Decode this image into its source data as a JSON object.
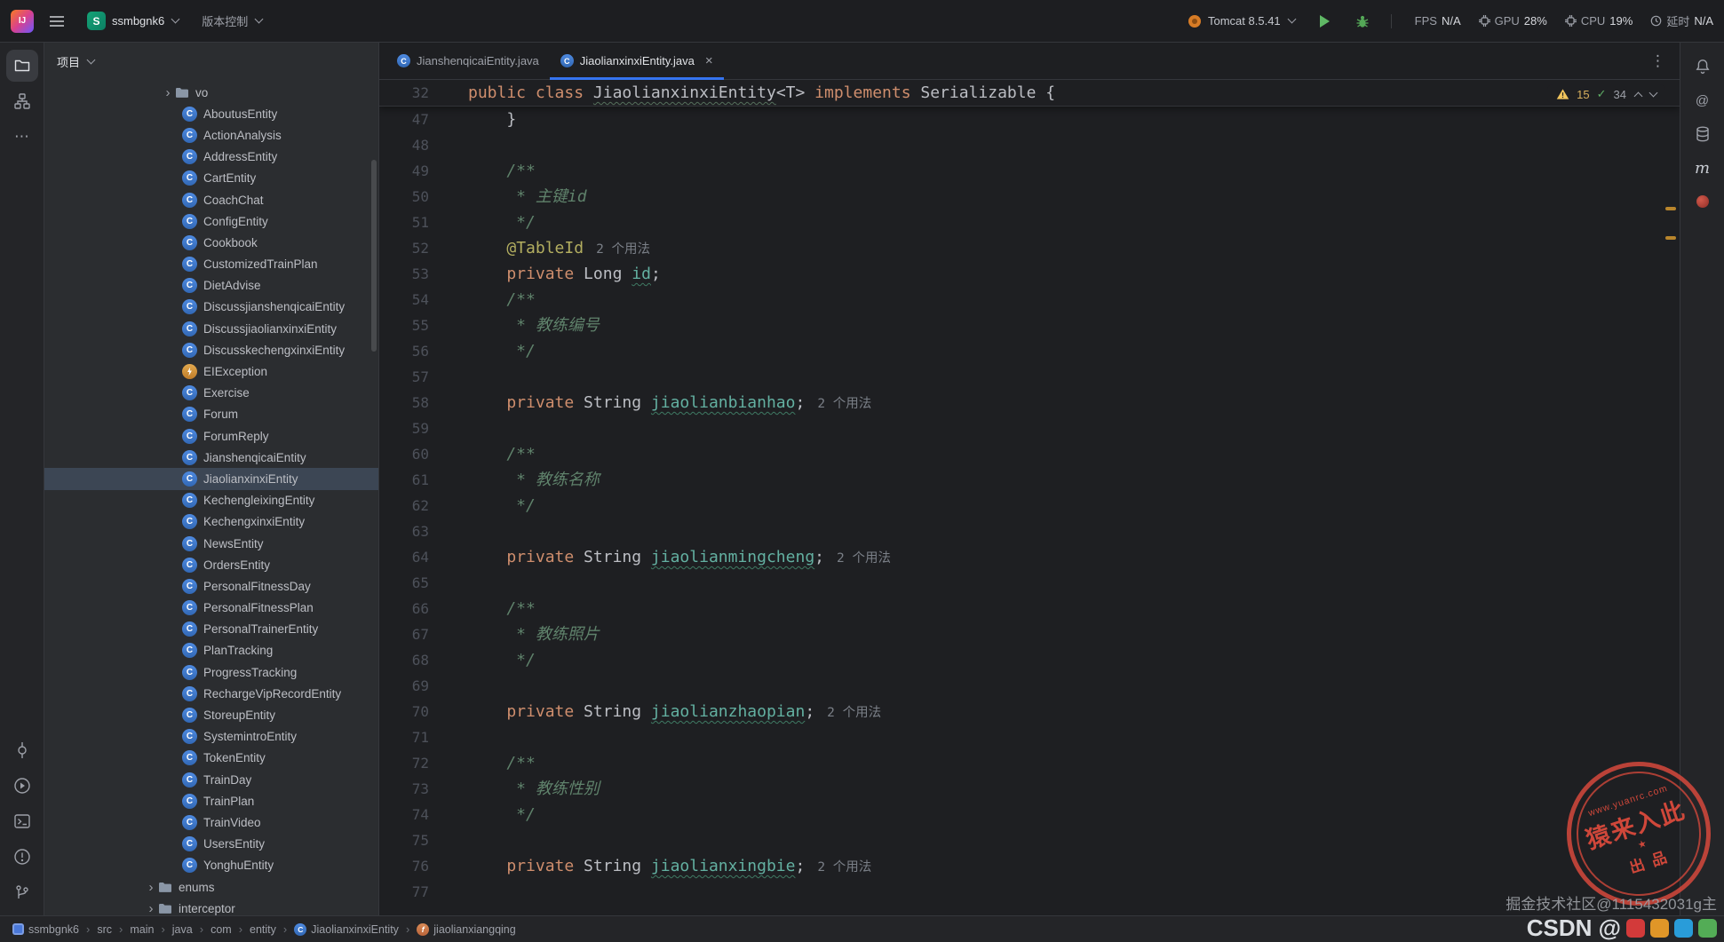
{
  "colors": {
    "accent_blue": "#3574f0",
    "editor_bg": "#1e1f22",
    "panel_bg": "#2b2d30",
    "keyword": "#cf8e6d",
    "doc_comment": "#5f826b",
    "annotation": "#b3ae60",
    "field": "#63b0a1",
    "warning_yellow": "#f2c55c",
    "success_green": "#5fad65",
    "stamp_red": "#d94a3c",
    "selection_row": "#3c4654"
  },
  "glyphs": {
    "chevron_right": "›",
    "close": "×",
    "kebab": "⋮",
    "more": "⋯",
    "check": "✓",
    "at": "@",
    "maven_m": "m",
    "star": "★",
    "class_icon_letter": "C",
    "field_icon_letter": "f",
    "logo_text": "IJ"
  },
  "titlebar": {
    "project": {
      "avatar_letter": "S",
      "name": "ssmbgnk6"
    },
    "vcs_label": "版本控制",
    "run_config_label": "Tomcat 8.5.41",
    "perf": {
      "fps_label": "FPS",
      "fps_value": "N/A",
      "gpu_label": "GPU",
      "gpu_value": "28%",
      "cpu_label": "CPU",
      "cpu_value": "19%",
      "latency_label": "延时",
      "latency_value": "N/A"
    }
  },
  "project_panel": {
    "title": "项目",
    "items": [
      {
        "label": "vo",
        "type": "folder",
        "chevron": true,
        "pad": 131
      },
      {
        "label": "AboutusEntity",
        "type": "class",
        "pad": 155
      },
      {
        "label": "ActionAnalysis",
        "type": "class",
        "pad": 155
      },
      {
        "label": "AddressEntity",
        "type": "class",
        "pad": 155
      },
      {
        "label": "CartEntity",
        "type": "class",
        "pad": 155
      },
      {
        "label": "CoachChat",
        "type": "class",
        "pad": 155
      },
      {
        "label": "ConfigEntity",
        "type": "class",
        "pad": 155
      },
      {
        "label": "Cookbook",
        "type": "class",
        "pad": 155
      },
      {
        "label": "CustomizedTrainPlan",
        "type": "class",
        "pad": 155
      },
      {
        "label": "DietAdvise",
        "type": "class",
        "pad": 155
      },
      {
        "label": "DiscussjianshenqicaiEntity",
        "type": "class",
        "pad": 155
      },
      {
        "label": "DiscussjiaolianxinxiEntity",
        "type": "class",
        "pad": 155
      },
      {
        "label": "DiscusskechengxinxiEntity",
        "type": "class",
        "pad": 155
      },
      {
        "label": "EIException",
        "type": "exception",
        "pad": 155
      },
      {
        "label": "Exercise",
        "type": "class",
        "pad": 155
      },
      {
        "label": "Forum",
        "type": "class",
        "pad": 155
      },
      {
        "label": "ForumReply",
        "type": "class",
        "pad": 155
      },
      {
        "label": "JianshenqicaiEntity",
        "type": "class",
        "pad": 155
      },
      {
        "label": "JiaolianxinxiEntity",
        "type": "class",
        "pad": 155,
        "selected": true
      },
      {
        "label": "KechengleixingEntity",
        "type": "class",
        "pad": 155
      },
      {
        "label": "KechengxinxiEntity",
        "type": "class",
        "pad": 155
      },
      {
        "label": "NewsEntity",
        "type": "class",
        "pad": 155
      },
      {
        "label": "OrdersEntity",
        "type": "class",
        "pad": 155
      },
      {
        "label": "PersonalFitnessDay",
        "type": "class",
        "pad": 155
      },
      {
        "label": "PersonalFitnessPlan",
        "type": "class",
        "pad": 155
      },
      {
        "label": "PersonalTrainerEntity",
        "type": "class",
        "pad": 155
      },
      {
        "label": "PlanTracking",
        "type": "class",
        "pad": 155
      },
      {
        "label": "ProgressTracking",
        "type": "class",
        "pad": 155
      },
      {
        "label": "RechargeVipRecordEntity",
        "type": "class",
        "pad": 155
      },
      {
        "label": "StoreupEntity",
        "type": "class",
        "pad": 155
      },
      {
        "label": "SystemintroEntity",
        "type": "class",
        "pad": 155
      },
      {
        "label": "TokenEntity",
        "type": "class",
        "pad": 155
      },
      {
        "label": "TrainDay",
        "type": "class",
        "pad": 155
      },
      {
        "label": "TrainPlan",
        "type": "class",
        "pad": 155
      },
      {
        "label": "TrainVideo",
        "type": "class",
        "pad": 155
      },
      {
        "label": "UsersEntity",
        "type": "class",
        "pad": 155
      },
      {
        "label": "YonghuEntity",
        "type": "class",
        "pad": 155
      },
      {
        "label": "enums",
        "type": "folder",
        "chevron": true,
        "pad": 112
      },
      {
        "label": "interceptor",
        "type": "folder",
        "chevron": true,
        "pad": 112
      }
    ]
  },
  "editor": {
    "tabs": [
      {
        "label": "JianshenqicaiEntity.java",
        "active": false
      },
      {
        "label": "JiaolianxinxiEntity.java",
        "active": true
      }
    ],
    "inspections": {
      "warnings": "15",
      "passed": "34"
    },
    "sticky_line": {
      "num": "32",
      "tokens": [
        [
          "kw",
          "public"
        ],
        [
          "pl",
          " "
        ],
        [
          "kw",
          "class"
        ],
        [
          "pl",
          " "
        ],
        [
          "cls",
          "JiaolianxinxiEntity"
        ],
        [
          "pl",
          "<T> "
        ],
        [
          "kw",
          "implements"
        ],
        [
          "pl",
          " Serializable {"
        ]
      ]
    },
    "lines": [
      {
        "num": "47",
        "tokens": [
          [
            "pl",
            "    }"
          ]
        ]
      },
      {
        "num": "48",
        "tokens": []
      },
      {
        "num": "49",
        "tokens": [
          [
            "doc",
            "    /**"
          ]
        ]
      },
      {
        "num": "50",
        "tokens": [
          [
            "doc",
            "     * 主键id"
          ]
        ]
      },
      {
        "num": "51",
        "tokens": [
          [
            "doc",
            "     */"
          ]
        ]
      },
      {
        "num": "52",
        "tokens": [
          [
            "pl",
            "    "
          ],
          [
            "ann",
            "@TableId"
          ],
          [
            "inlay",
            "2 个用法"
          ]
        ]
      },
      {
        "num": "53",
        "tokens": [
          [
            "pl",
            "    "
          ],
          [
            "kw",
            "private"
          ],
          [
            "pl",
            " Long "
          ],
          [
            "fld",
            "id"
          ],
          [
            "pl",
            ";"
          ]
        ]
      },
      {
        "num": "54",
        "tokens": [
          [
            "doc",
            "    /**"
          ]
        ]
      },
      {
        "num": "55",
        "tokens": [
          [
            "doc",
            "     * 教练编号"
          ]
        ]
      },
      {
        "num": "56",
        "tokens": [
          [
            "doc",
            "     */"
          ]
        ]
      },
      {
        "num": "57",
        "tokens": []
      },
      {
        "num": "58",
        "tokens": [
          [
            "pl",
            "    "
          ],
          [
            "kw",
            "private"
          ],
          [
            "pl",
            " String "
          ],
          [
            "fld",
            "jiaolianbianhao"
          ],
          [
            "pl",
            ";"
          ],
          [
            "inlay",
            "2 个用法"
          ]
        ]
      },
      {
        "num": "59",
        "tokens": []
      },
      {
        "num": "60",
        "tokens": [
          [
            "doc",
            "    /**"
          ]
        ]
      },
      {
        "num": "61",
        "tokens": [
          [
            "doc",
            "     * 教练名称"
          ]
        ]
      },
      {
        "num": "62",
        "tokens": [
          [
            "doc",
            "     */"
          ]
        ]
      },
      {
        "num": "63",
        "tokens": []
      },
      {
        "num": "64",
        "tokens": [
          [
            "pl",
            "    "
          ],
          [
            "kw",
            "private"
          ],
          [
            "pl",
            " String "
          ],
          [
            "fld",
            "jiaolianmingcheng"
          ],
          [
            "pl",
            ";"
          ],
          [
            "inlay",
            "2 个用法"
          ]
        ]
      },
      {
        "num": "65",
        "tokens": []
      },
      {
        "num": "66",
        "tokens": [
          [
            "doc",
            "    /**"
          ]
        ]
      },
      {
        "num": "67",
        "tokens": [
          [
            "doc",
            "     * 教练照片"
          ]
        ]
      },
      {
        "num": "68",
        "tokens": [
          [
            "doc",
            "     */"
          ]
        ]
      },
      {
        "num": "69",
        "tokens": []
      },
      {
        "num": "70",
        "tokens": [
          [
            "pl",
            "    "
          ],
          [
            "kw",
            "private"
          ],
          [
            "pl",
            " String "
          ],
          [
            "fld",
            "jiaolianzhaopian"
          ],
          [
            "pl",
            ";"
          ],
          [
            "inlay",
            "2 个用法"
          ]
        ]
      },
      {
        "num": "71",
        "tokens": []
      },
      {
        "num": "72",
        "tokens": [
          [
            "doc",
            "    /**"
          ]
        ]
      },
      {
        "num": "73",
        "tokens": [
          [
            "doc",
            "     * 教练性别"
          ]
        ]
      },
      {
        "num": "74",
        "tokens": [
          [
            "doc",
            "     */"
          ]
        ]
      },
      {
        "num": "75",
        "tokens": []
      },
      {
        "num": "76",
        "tokens": [
          [
            "pl",
            "    "
          ],
          [
            "kw",
            "private"
          ],
          [
            "pl",
            " String "
          ],
          [
            "fld",
            "jiaolianxingbie"
          ],
          [
            "pl",
            ";"
          ],
          [
            "inlay",
            "2 个用法"
          ]
        ]
      },
      {
        "num": "77",
        "tokens": []
      }
    ]
  },
  "breadcrumbs": {
    "items": [
      {
        "label": "ssmbgnk6",
        "icon": "module"
      },
      {
        "label": "src"
      },
      {
        "label": "main"
      },
      {
        "label": "java"
      },
      {
        "label": "com"
      },
      {
        "label": "entity"
      },
      {
        "label": "JiaolianxinxiEntity",
        "icon": "class"
      },
      {
        "label": "jiaolianxiangqing",
        "icon": "field"
      }
    ]
  },
  "watermark": {
    "stamp_url": "www.yuanrc.com",
    "stamp_main": "猿来入此",
    "stamp_sub": "出品",
    "credit_line1": "掘金技术社区@1115432031g主",
    "credit_line2": "CSDN @"
  }
}
